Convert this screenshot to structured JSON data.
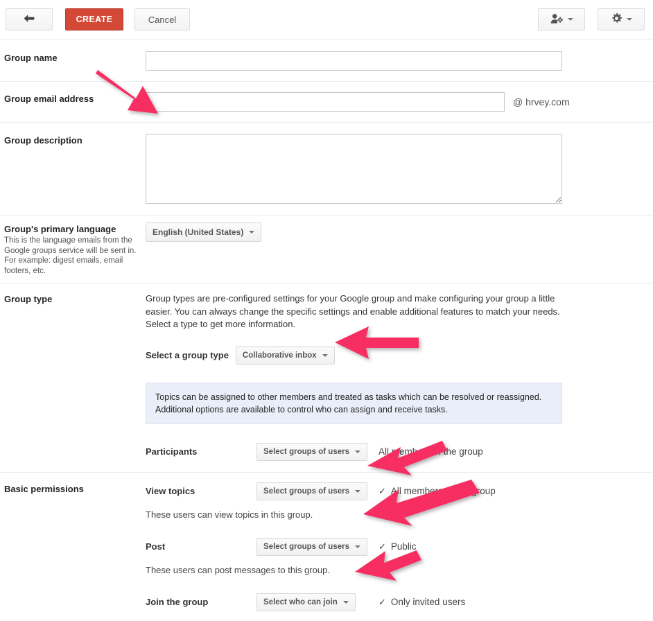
{
  "toolbar": {
    "back_label": "",
    "back_icon": "back-arrow-icon",
    "create_label": "CREATE",
    "cancel_label": "Cancel",
    "members_icon": "person-gear-icon",
    "settings_icon": "gear-icon",
    "create_color": "#d34836"
  },
  "form": {
    "group_name": {
      "label": "Group name",
      "value": "",
      "placeholder": ""
    },
    "group_email": {
      "label": "Group email address",
      "value": "",
      "placeholder": "",
      "domain_suffix": "@ hrvey.com"
    },
    "group_description": {
      "label": "Group description",
      "value": "",
      "placeholder": ""
    },
    "language": {
      "label": "Group's primary language",
      "sublabel": "This is the language emails from the Google groups service will be sent in. For example: digest emails, email footers, etc.",
      "selected": "English (United States)"
    },
    "group_type": {
      "label": "Group type",
      "description": "Group types are pre-configured settings for your Google group and make configuring your group a little easier. You can always change the specific settings and enable additional features to match your needs. Select a type to get more information.",
      "select_label": "Select a group type",
      "selected": "Collaborative inbox",
      "info_text": "Topics can be assigned to other members and treated as tasks which can be resolved or reassigned. Additional options are available to control who can assign and receive tasks.",
      "info_bg": "#e9eef8",
      "participants": {
        "name": "Participants",
        "dropdown": "Select groups of users",
        "value": "All members of the group",
        "checked": false
      }
    },
    "basic_permissions": {
      "label": "Basic permissions",
      "rows": [
        {
          "name": "View topics",
          "dropdown": "Select groups of users",
          "value": "All members of the group",
          "checked": true,
          "help": "These users can view topics in this group."
        },
        {
          "name": "Post",
          "dropdown": "Select groups of users",
          "value": "Public",
          "checked": true,
          "help": "These users can post messages to this group."
        },
        {
          "name": "Join the group",
          "dropdown": "Select who can join",
          "value": "Only invited users",
          "checked": true,
          "help": ""
        }
      ]
    }
  },
  "annotations": {
    "arrow_color": "#f72d62",
    "count": 5
  }
}
